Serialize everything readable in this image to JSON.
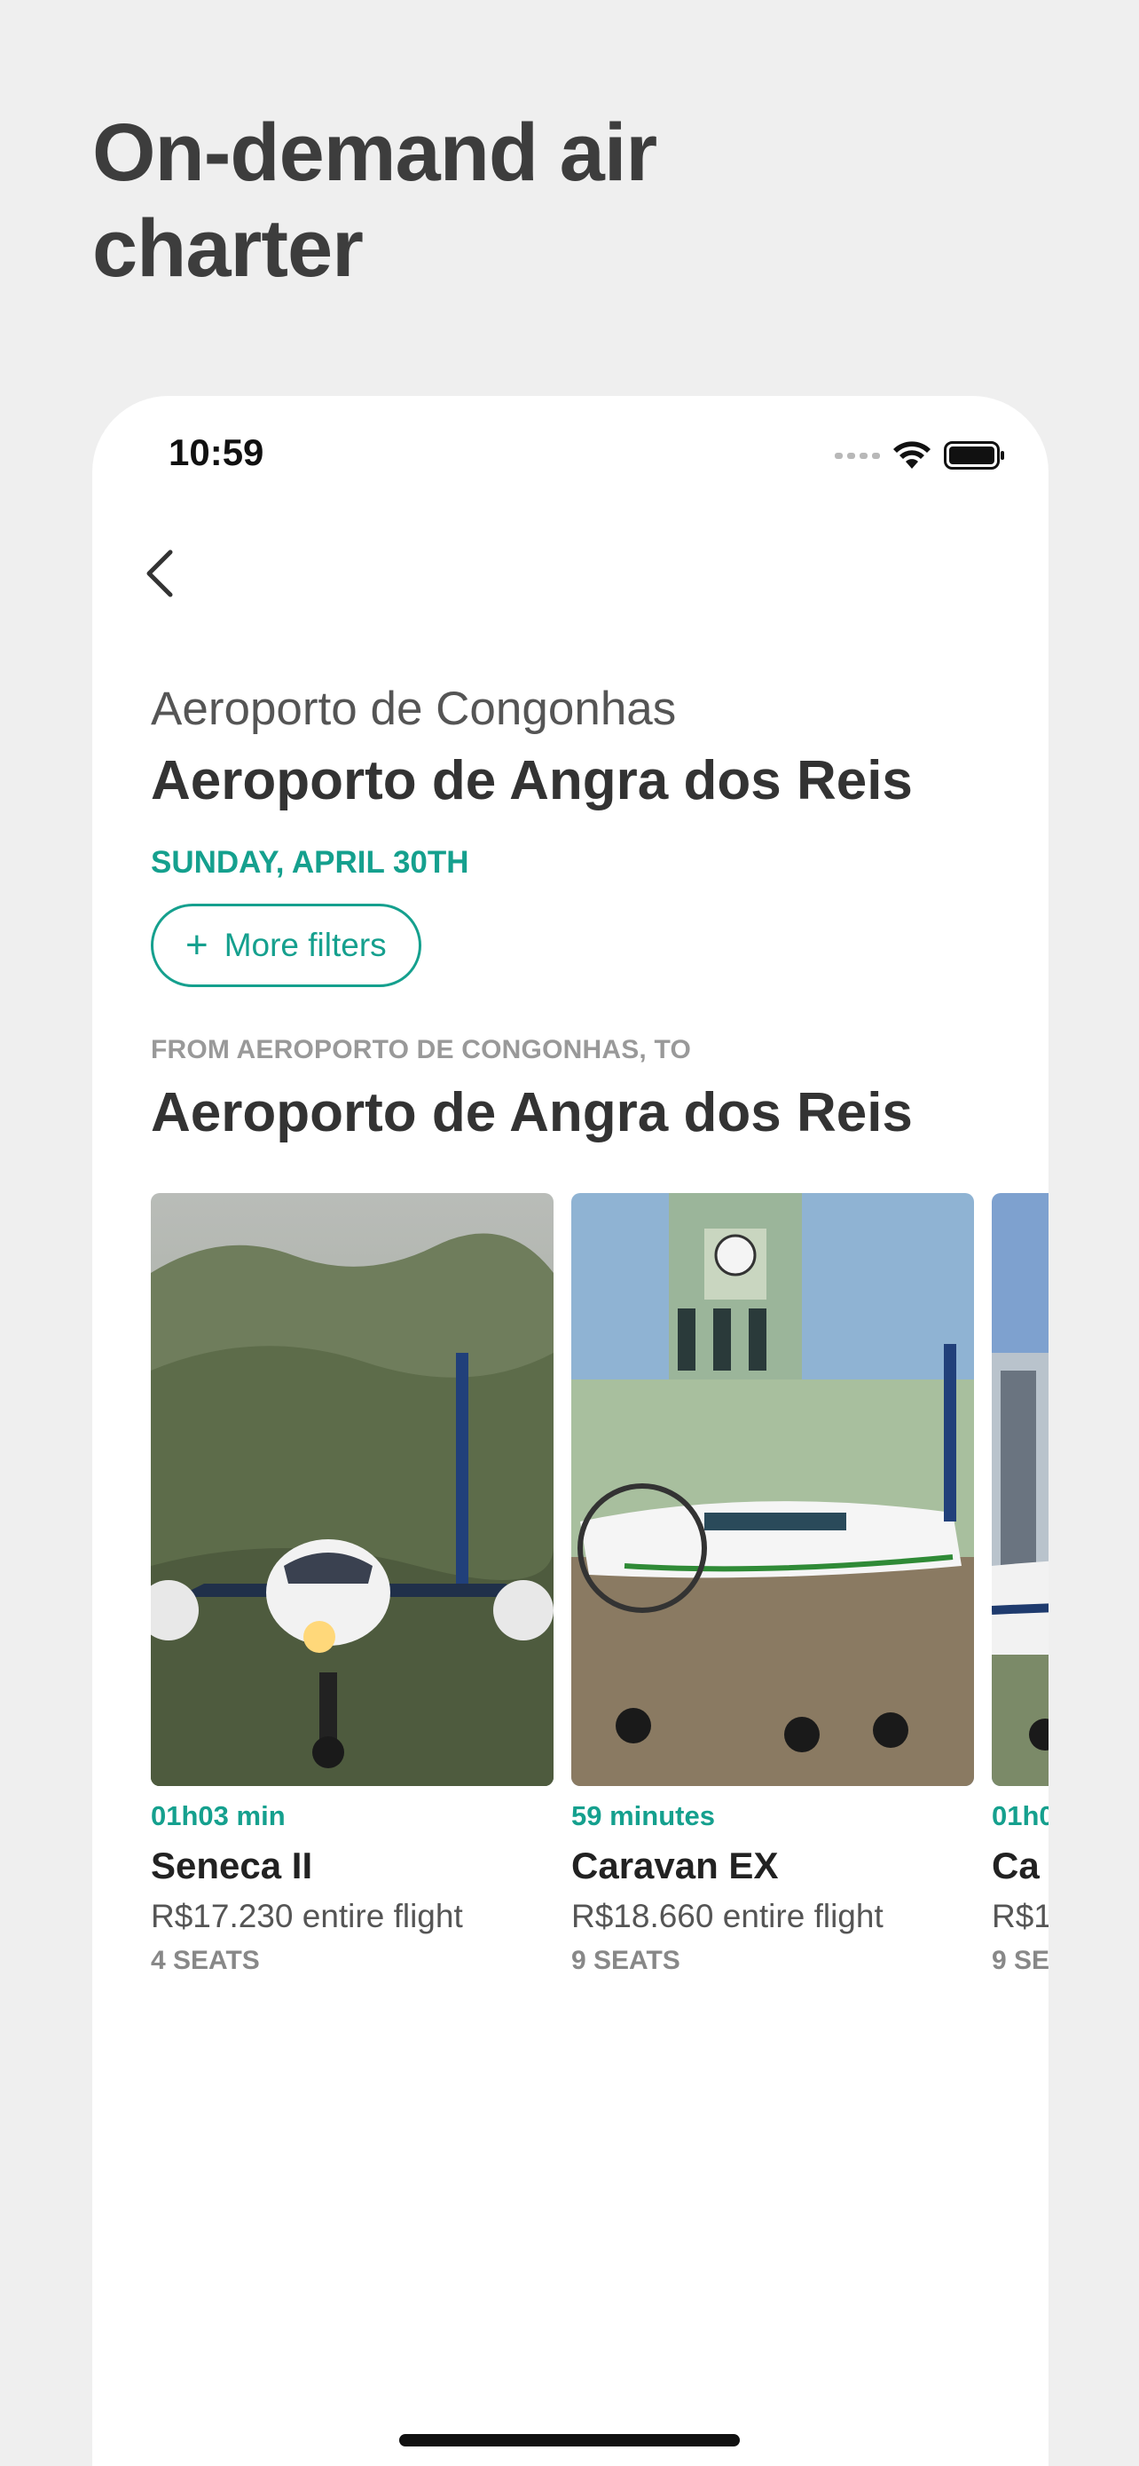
{
  "hero": {
    "title": "On-demand air charter"
  },
  "status_bar": {
    "time": "10:59"
  },
  "route": {
    "origin": "Aeroporto de Congonhas",
    "destination": "Aeroporto de Angra dos Reis",
    "date": "SUNDAY, APRIL 30TH"
  },
  "filters": {
    "label": "More filters",
    "icon": "plus-icon"
  },
  "section": {
    "kicker": "FROM AEROPORTO DE CONGONHAS, TO",
    "title": "Aeroporto de Angra dos Reis"
  },
  "flights": [
    {
      "duration": "01h03 min",
      "name": "Seneca II",
      "price": "R$17.230 entire flight",
      "seats": "4 SEATS"
    },
    {
      "duration": "59 minutes",
      "name": "Caravan EX",
      "price": "R$18.660 entire flight",
      "seats": "9 SEATS"
    },
    {
      "duration": "01h0",
      "name": "Ca",
      "price": "R$1",
      "seats": "9 SE"
    }
  ],
  "colors": {
    "accent": "#15a08e",
    "background": "#efefef",
    "card": "#ffffff"
  }
}
